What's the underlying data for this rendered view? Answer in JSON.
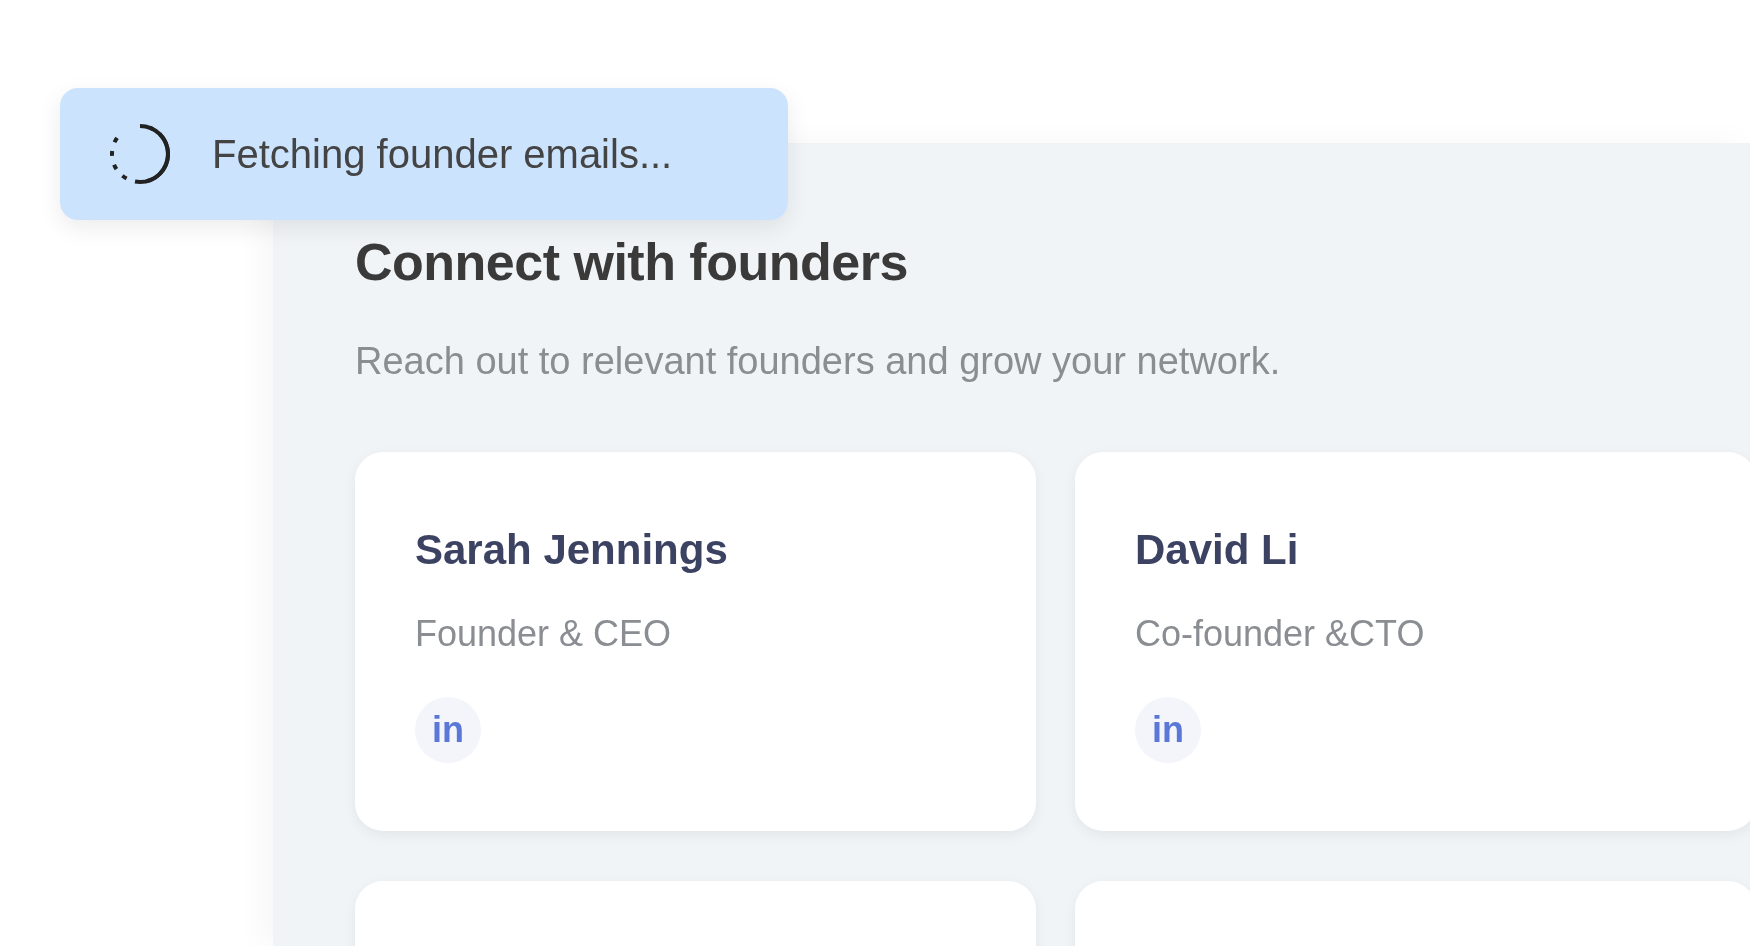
{
  "toast": {
    "kind": "loading",
    "message": "Fetching founder emails..."
  },
  "panel": {
    "title": "Connect with founders",
    "subtitle": "Reach out to relevant founders and grow your network.",
    "founders": [
      {
        "kind": "founder",
        "name": "Sarah Jennings",
        "role": "Founder & CEO",
        "link_label": "in"
      },
      {
        "kind": "founder",
        "name": "David Li",
        "role": "Co-founder &CTO",
        "link_label": "in"
      },
      {
        "kind": "cut"
      },
      {
        "kind": "cut"
      }
    ]
  }
}
